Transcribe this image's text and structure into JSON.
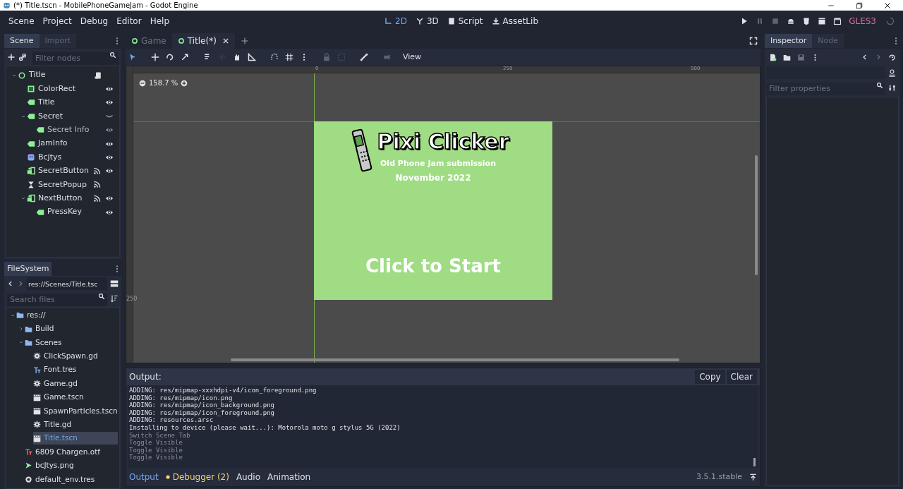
{
  "window": {
    "title": "(*) Title.tscn - MobilePhoneGameJam - Godot Engine"
  },
  "menu": [
    "Scene",
    "Project",
    "Debug",
    "Editor",
    "Help"
  ],
  "workspaces": [
    {
      "label": "2D",
      "kind": "planar",
      "selected": true
    },
    {
      "label": "3D",
      "kind": "spatial",
      "selected": false
    },
    {
      "label": "Script",
      "kind": "script",
      "selected": false
    },
    {
      "label": "AssetLib",
      "kind": "assetlib",
      "selected": false
    }
  ],
  "renderer": "GLES3",
  "scene_dock": {
    "tabs": [
      {
        "label": "Scene",
        "selected": true
      },
      {
        "label": "Import",
        "selected": false
      }
    ],
    "filter_placeholder": "Filter nodes",
    "tree": [
      {
        "name": "Title",
        "kind": "node",
        "script": true,
        "signals": false,
        "visibility_toggle": false,
        "expanded": true,
        "children": [
          {
            "name": "ColorRect",
            "kind": "colorrect",
            "script": false,
            "signals": false,
            "visibility_toggle": true,
            "visible": true
          },
          {
            "name": "Title",
            "kind": "label",
            "script": false,
            "signals": false,
            "visibility_toggle": true,
            "visible": true
          },
          {
            "name": "Secret",
            "kind": "label",
            "script": false,
            "signals": false,
            "visibility_toggle": true,
            "visible": false,
            "expanded": true,
            "children": [
              {
                "name": "Secret Info",
                "kind": "label",
                "script": false,
                "signals": false,
                "visibility_toggle": true,
                "visible": true
              }
            ]
          },
          {
            "name": "JamInfo",
            "kind": "label",
            "script": false,
            "signals": false,
            "visibility_toggle": true,
            "visible": true
          },
          {
            "name": "Bcjtys",
            "kind": "texture",
            "script": false,
            "signals": false,
            "visibility_toggle": true,
            "visible": true
          },
          {
            "name": "SecretButton",
            "kind": "button",
            "script": false,
            "signals": true,
            "visibility_toggle": true,
            "visible": true
          },
          {
            "name": "SecretPopup",
            "kind": "popup",
            "script": false,
            "signals": true,
            "visibility_toggle": false
          },
          {
            "name": "NextButton",
            "kind": "button",
            "script": false,
            "signals": true,
            "visibility_toggle": true,
            "visible": true,
            "expanded": true,
            "children": [
              {
                "name": "PressKey",
                "kind": "label",
                "script": false,
                "signals": false,
                "visibility_toggle": true,
                "visible": true
              }
            ]
          }
        ]
      }
    ]
  },
  "filesystem": {
    "title": "FileSystem",
    "path": "res://Scenes/Title.tsc",
    "search_placeholder": "Search files",
    "tree": [
      {
        "name": "res://",
        "kind": "folder",
        "expanded": true,
        "selected": false,
        "children": [
          {
            "name": "Build",
            "kind": "folder",
            "expanded": false,
            "selected": false
          },
          {
            "name": "Scenes",
            "kind": "folder",
            "expanded": true,
            "selected": false,
            "children": [
              {
                "name": "ClickSpawn.gd",
                "kind": "script",
                "selected": false
              },
              {
                "name": "Font.tres",
                "kind": "font",
                "selected": false
              },
              {
                "name": "Game.gd",
                "kind": "script",
                "selected": false
              },
              {
                "name": "Game.tscn",
                "kind": "scene",
                "selected": false
              },
              {
                "name": "SpawnParticles.tscn",
                "kind": "scene",
                "selected": false
              },
              {
                "name": "Title.gd",
                "kind": "script",
                "selected": false
              },
              {
                "name": "Title.tscn",
                "kind": "scene",
                "selected": true
              }
            ]
          },
          {
            "name": "6809 Chargen.otf",
            "kind": "fontfile",
            "selected": false
          },
          {
            "name": "bcJtys.png",
            "kind": "image",
            "selected": false
          },
          {
            "name": "default_env.tres",
            "kind": "resource",
            "selected": false
          }
        ]
      }
    ]
  },
  "editor_tabs": [
    {
      "label": "Game",
      "selected": false
    },
    {
      "label": "Title(*)",
      "selected": true
    }
  ],
  "canvas_toolbar": {
    "view_menu": "View"
  },
  "canvas": {
    "zoom": "158.7 %",
    "ruler_labels": [
      "0",
      "250",
      "500"
    ],
    "ruler_left_label": "250",
    "game": {
      "title": "Pixi Clicker",
      "subtitle": "Old Phone Jam submission",
      "date": "November 2022",
      "prompt": "Click to Start"
    }
  },
  "output": {
    "title": "Output:",
    "buttons": [
      "Copy",
      "Clear"
    ],
    "lines": [
      {
        "text": "ADDING: res/mipmap-xxxhdpi-v4/icon_foreground.png",
        "kind": "normal"
      },
      {
        "text": "ADDING: res/mipmap/icon.png",
        "kind": "normal"
      },
      {
        "text": "ADDING: res/mipmap/icon_background.png",
        "kind": "normal"
      },
      {
        "text": "ADDING: res/mipmap/icon_foreground.png",
        "kind": "normal"
      },
      {
        "text": "ADDING: resources.arsc",
        "kind": "normal"
      },
      {
        "text": "Installing to device (please wait...): Motorola moto g stylus 5G (2022)",
        "kind": "normal"
      },
      {
        "text": "Switch Scene Tab",
        "kind": "action"
      },
      {
        "text": "Toggle Visible",
        "kind": "action"
      },
      {
        "text": "Toggle Visible",
        "kind": "action"
      },
      {
        "text": "Toggle Visible",
        "kind": "action"
      }
    ]
  },
  "bottom_tabs": [
    {
      "label": "Output",
      "selected": true,
      "alert": false
    },
    {
      "label": "Debugger (2)",
      "selected": false,
      "alert": true
    },
    {
      "label": "Audio",
      "selected": false,
      "alert": false
    },
    {
      "label": "Animation",
      "selected": false,
      "alert": false
    }
  ],
  "version": "3.5.1.stable",
  "inspector": {
    "tabs": [
      {
        "label": "Inspector",
        "selected": true
      },
      {
        "label": "Node",
        "selected": false
      }
    ],
    "filter_placeholder": "Filter properties"
  }
}
